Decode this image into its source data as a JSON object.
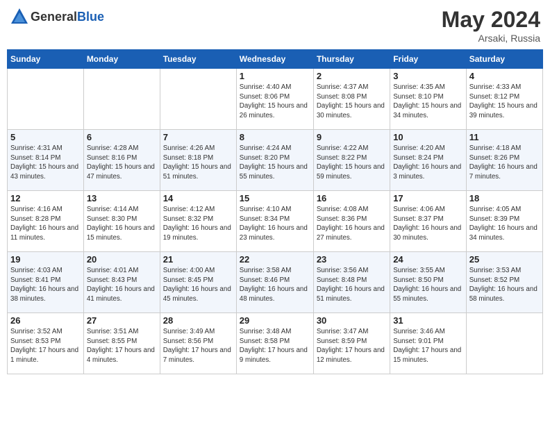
{
  "header": {
    "logo_general": "General",
    "logo_blue": "Blue",
    "title": "May 2024",
    "location": "Arsaki, Russia"
  },
  "weekdays": [
    "Sunday",
    "Monday",
    "Tuesday",
    "Wednesday",
    "Thursday",
    "Friday",
    "Saturday"
  ],
  "weeks": [
    [
      {
        "day": "",
        "sunrise": "",
        "sunset": "",
        "daylight": ""
      },
      {
        "day": "",
        "sunrise": "",
        "sunset": "",
        "daylight": ""
      },
      {
        "day": "",
        "sunrise": "",
        "sunset": "",
        "daylight": ""
      },
      {
        "day": "1",
        "sunrise": "Sunrise: 4:40 AM",
        "sunset": "Sunset: 8:06 PM",
        "daylight": "Daylight: 15 hours and 26 minutes."
      },
      {
        "day": "2",
        "sunrise": "Sunrise: 4:37 AM",
        "sunset": "Sunset: 8:08 PM",
        "daylight": "Daylight: 15 hours and 30 minutes."
      },
      {
        "day": "3",
        "sunrise": "Sunrise: 4:35 AM",
        "sunset": "Sunset: 8:10 PM",
        "daylight": "Daylight: 15 hours and 34 minutes."
      },
      {
        "day": "4",
        "sunrise": "Sunrise: 4:33 AM",
        "sunset": "Sunset: 8:12 PM",
        "daylight": "Daylight: 15 hours and 39 minutes."
      }
    ],
    [
      {
        "day": "5",
        "sunrise": "Sunrise: 4:31 AM",
        "sunset": "Sunset: 8:14 PM",
        "daylight": "Daylight: 15 hours and 43 minutes."
      },
      {
        "day": "6",
        "sunrise": "Sunrise: 4:28 AM",
        "sunset": "Sunset: 8:16 PM",
        "daylight": "Daylight: 15 hours and 47 minutes."
      },
      {
        "day": "7",
        "sunrise": "Sunrise: 4:26 AM",
        "sunset": "Sunset: 8:18 PM",
        "daylight": "Daylight: 15 hours and 51 minutes."
      },
      {
        "day": "8",
        "sunrise": "Sunrise: 4:24 AM",
        "sunset": "Sunset: 8:20 PM",
        "daylight": "Daylight: 15 hours and 55 minutes."
      },
      {
        "day": "9",
        "sunrise": "Sunrise: 4:22 AM",
        "sunset": "Sunset: 8:22 PM",
        "daylight": "Daylight: 15 hours and 59 minutes."
      },
      {
        "day": "10",
        "sunrise": "Sunrise: 4:20 AM",
        "sunset": "Sunset: 8:24 PM",
        "daylight": "Daylight: 16 hours and 3 minutes."
      },
      {
        "day": "11",
        "sunrise": "Sunrise: 4:18 AM",
        "sunset": "Sunset: 8:26 PM",
        "daylight": "Daylight: 16 hours and 7 minutes."
      }
    ],
    [
      {
        "day": "12",
        "sunrise": "Sunrise: 4:16 AM",
        "sunset": "Sunset: 8:28 PM",
        "daylight": "Daylight: 16 hours and 11 minutes."
      },
      {
        "day": "13",
        "sunrise": "Sunrise: 4:14 AM",
        "sunset": "Sunset: 8:30 PM",
        "daylight": "Daylight: 16 hours and 15 minutes."
      },
      {
        "day": "14",
        "sunrise": "Sunrise: 4:12 AM",
        "sunset": "Sunset: 8:32 PM",
        "daylight": "Daylight: 16 hours and 19 minutes."
      },
      {
        "day": "15",
        "sunrise": "Sunrise: 4:10 AM",
        "sunset": "Sunset: 8:34 PM",
        "daylight": "Daylight: 16 hours and 23 minutes."
      },
      {
        "day": "16",
        "sunrise": "Sunrise: 4:08 AM",
        "sunset": "Sunset: 8:36 PM",
        "daylight": "Daylight: 16 hours and 27 minutes."
      },
      {
        "day": "17",
        "sunrise": "Sunrise: 4:06 AM",
        "sunset": "Sunset: 8:37 PM",
        "daylight": "Daylight: 16 hours and 30 minutes."
      },
      {
        "day": "18",
        "sunrise": "Sunrise: 4:05 AM",
        "sunset": "Sunset: 8:39 PM",
        "daylight": "Daylight: 16 hours and 34 minutes."
      }
    ],
    [
      {
        "day": "19",
        "sunrise": "Sunrise: 4:03 AM",
        "sunset": "Sunset: 8:41 PM",
        "daylight": "Daylight: 16 hours and 38 minutes."
      },
      {
        "day": "20",
        "sunrise": "Sunrise: 4:01 AM",
        "sunset": "Sunset: 8:43 PM",
        "daylight": "Daylight: 16 hours and 41 minutes."
      },
      {
        "day": "21",
        "sunrise": "Sunrise: 4:00 AM",
        "sunset": "Sunset: 8:45 PM",
        "daylight": "Daylight: 16 hours and 45 minutes."
      },
      {
        "day": "22",
        "sunrise": "Sunrise: 3:58 AM",
        "sunset": "Sunset: 8:46 PM",
        "daylight": "Daylight: 16 hours and 48 minutes."
      },
      {
        "day": "23",
        "sunrise": "Sunrise: 3:56 AM",
        "sunset": "Sunset: 8:48 PM",
        "daylight": "Daylight: 16 hours and 51 minutes."
      },
      {
        "day": "24",
        "sunrise": "Sunrise: 3:55 AM",
        "sunset": "Sunset: 8:50 PM",
        "daylight": "Daylight: 16 hours and 55 minutes."
      },
      {
        "day": "25",
        "sunrise": "Sunrise: 3:53 AM",
        "sunset": "Sunset: 8:52 PM",
        "daylight": "Daylight: 16 hours and 58 minutes."
      }
    ],
    [
      {
        "day": "26",
        "sunrise": "Sunrise: 3:52 AM",
        "sunset": "Sunset: 8:53 PM",
        "daylight": "Daylight: 17 hours and 1 minute."
      },
      {
        "day": "27",
        "sunrise": "Sunrise: 3:51 AM",
        "sunset": "Sunset: 8:55 PM",
        "daylight": "Daylight: 17 hours and 4 minutes."
      },
      {
        "day": "28",
        "sunrise": "Sunrise: 3:49 AM",
        "sunset": "Sunset: 8:56 PM",
        "daylight": "Daylight: 17 hours and 7 minutes."
      },
      {
        "day": "29",
        "sunrise": "Sunrise: 3:48 AM",
        "sunset": "Sunset: 8:58 PM",
        "daylight": "Daylight: 17 hours and 9 minutes."
      },
      {
        "day": "30",
        "sunrise": "Sunrise: 3:47 AM",
        "sunset": "Sunset: 8:59 PM",
        "daylight": "Daylight: 17 hours and 12 minutes."
      },
      {
        "day": "31",
        "sunrise": "Sunrise: 3:46 AM",
        "sunset": "Sunset: 9:01 PM",
        "daylight": "Daylight: 17 hours and 15 minutes."
      },
      {
        "day": "",
        "sunrise": "",
        "sunset": "",
        "daylight": ""
      }
    ]
  ]
}
